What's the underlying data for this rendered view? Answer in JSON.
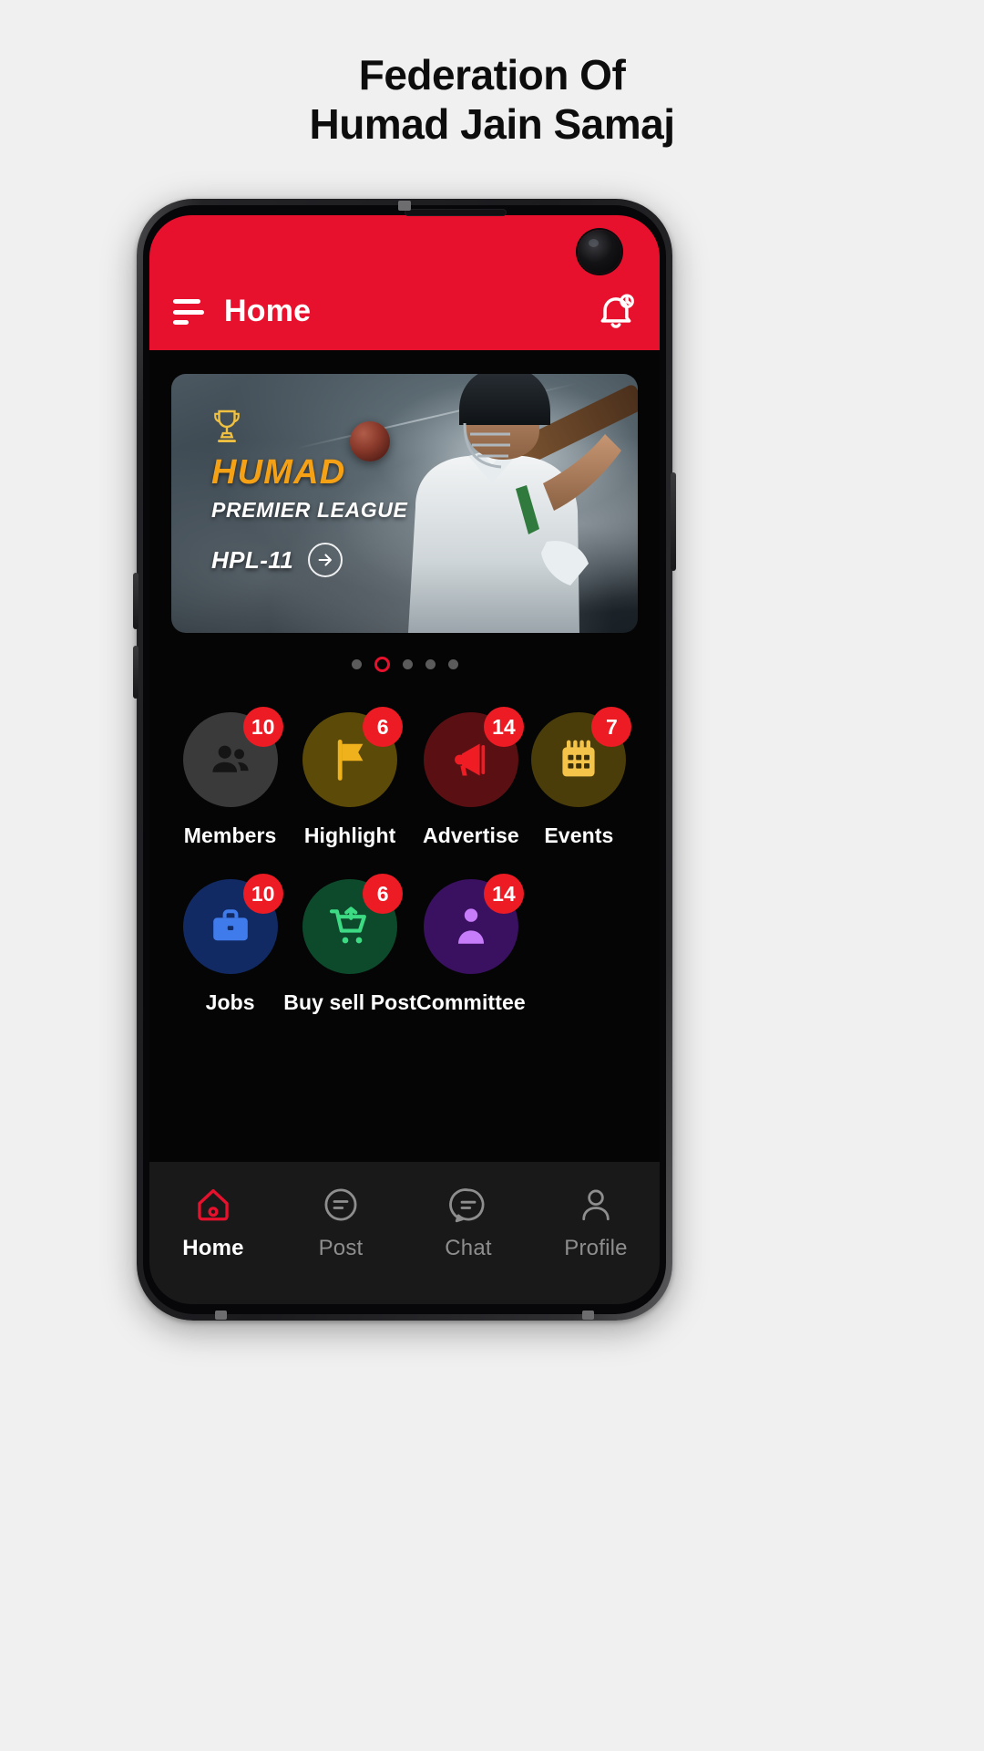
{
  "page": {
    "title_line1": "Federation Of",
    "title_line2": "Humad Jain Samaj",
    "background_color": "#f0f0f0",
    "title_color": "#0d0d0d"
  },
  "appbar": {
    "title": "Home",
    "menu_icon": "hamburger-menu-icon",
    "notification_icon": "bell-icon",
    "background_color": "#e8112d",
    "text_color": "#ffffff"
  },
  "banner": {
    "title": "HUMAD",
    "subtitle": "PREMIER LEAGUE",
    "season": "HPL-11",
    "cta_icon": "arrow-right-icon",
    "trophy_icon": "trophy-icon",
    "title_color": "#f5a116",
    "subtitle_color": "#ffffff"
  },
  "carousel": {
    "total_dots": 5,
    "active_index": 1,
    "active_color": "#e8112d",
    "inactive_color": "#5b5b5b"
  },
  "grid": {
    "tiles": [
      {
        "label": "Members",
        "badge": "10",
        "icon": "members-group-icon",
        "circle_color": "#3a3a3a",
        "icon_color": "#1a1a1a"
      },
      {
        "label": "Highlight",
        "badge": "6",
        "icon": "flag-icon",
        "circle_color": "#5c4a08",
        "icon_color": "#f0b21c"
      },
      {
        "label": "Advertise",
        "badge": "14",
        "icon": "megaphone-icon",
        "circle_color": "#5a0f13",
        "icon_color": "#ef1c24"
      },
      {
        "label": "Events",
        "badge": "7",
        "icon": "calendar-icon",
        "circle_color": "#4b3d0a",
        "icon_color": "#f4c44a"
      },
      {
        "label": "Jobs",
        "badge": "10",
        "icon": "briefcase-icon",
        "circle_color": "#122a63",
        "icon_color": "#3f7bea"
      },
      {
        "label": "Buy sell Post",
        "badge": "6",
        "icon": "shopping-cart-icon",
        "circle_color": "#0d4a2c",
        "icon_color": "#3ddc84"
      },
      {
        "label": "Committee",
        "badge": "14",
        "icon": "user-badge-icon",
        "circle_color": "#3a1060",
        "icon_color": "#c77dfa"
      }
    ],
    "badge_color": "#ed1b24",
    "label_color": "#ffffff"
  },
  "bottomnav": {
    "items": [
      {
        "label": "Home",
        "icon": "home-icon",
        "active": true
      },
      {
        "label": "Post",
        "icon": "post-icon",
        "active": false
      },
      {
        "label": "Chat",
        "icon": "chat-icon",
        "active": false
      },
      {
        "label": "Profile",
        "icon": "profile-icon",
        "active": false
      }
    ],
    "active_color": "#e8112d",
    "inactive_color": "#8e8e8e",
    "background_color": "#191919"
  }
}
